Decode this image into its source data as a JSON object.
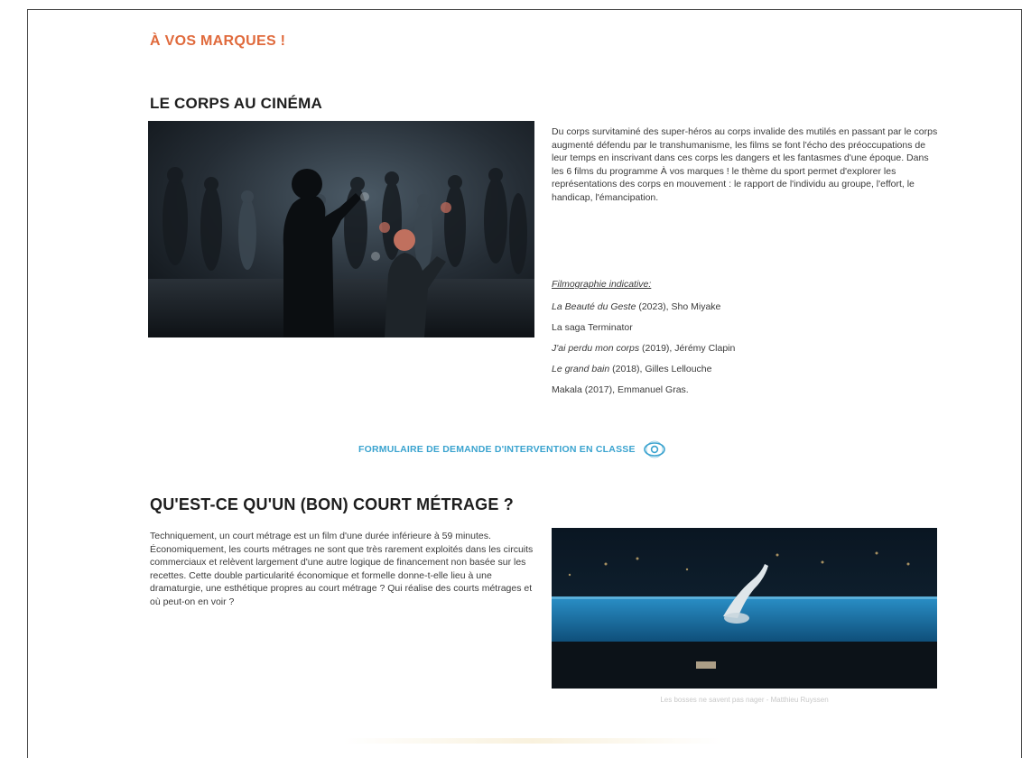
{
  "header": {
    "section_label": "À VOS MARQUES !"
  },
  "body_section": {
    "title": "LE CORPS AU CINÉMA",
    "image_alt": "Danseurs sur une scène sombre",
    "paragraph": "Du corps survitaminé des super-héros au corps invalide des mutilés en passant par le corps augmenté défendu par le transhumanisme, les films se font l'écho des préoccupations de leur temps en inscrivant dans ces corps les dangers et les fantasmes d'une époque. Dans les 6 films du programme À vos marques ! le thème du sport permet d'explorer les représentations des corps en mouvement : le rapport de l'individu au groupe, l'effort, le handicap, l'émancipation.",
    "filmo_title": "Filmographie indicative:",
    "filmography": [
      {
        "title": "La Beauté du Geste",
        "rest": " (2023), Sho Miyake"
      },
      {
        "title": "",
        "rest": "La saga Terminator"
      },
      {
        "title": "J'ai perdu mon corps",
        "rest": " (2019), Jérémy Clapin"
      },
      {
        "title": "Le grand bain",
        "rest": " (2018), Gilles Lellouche"
      },
      {
        "title": "",
        "rest": "Makala (2017), Emmanuel Gras."
      }
    ]
  },
  "form_link": {
    "label": "FORMULAIRE DE DEMANDE D'INTERVENTION EN CLASSE",
    "icon": "eye-icon",
    "color": "#3aa3cf"
  },
  "short_section": {
    "title": "QU'EST-CE QU'UN (BON) COURT MÉTRAGE ?",
    "paragraph": "Techniquement, un court métrage est un film d'une durée inférieure à 59 minutes. Économiquement, les courts métrages ne sont que très rarement exploités dans les circuits commerciaux et relèvent largement d'une autre logique de financement non basée sur les recettes. Cette double particularité économique et formelle donne-t-elle lieu à une dramaturgie, une esthétique propres au court métrage ? Qui réalise des courts métrages et où peut-on en voir ?",
    "image_alt": "Nageuse dans une piscine éclairée la nuit",
    "caption": "Les bosses ne savent pas nager - Matthieu Ruyssen"
  },
  "colors": {
    "accent_orange": "#e06a3c",
    "link_blue": "#3aa3cf"
  }
}
